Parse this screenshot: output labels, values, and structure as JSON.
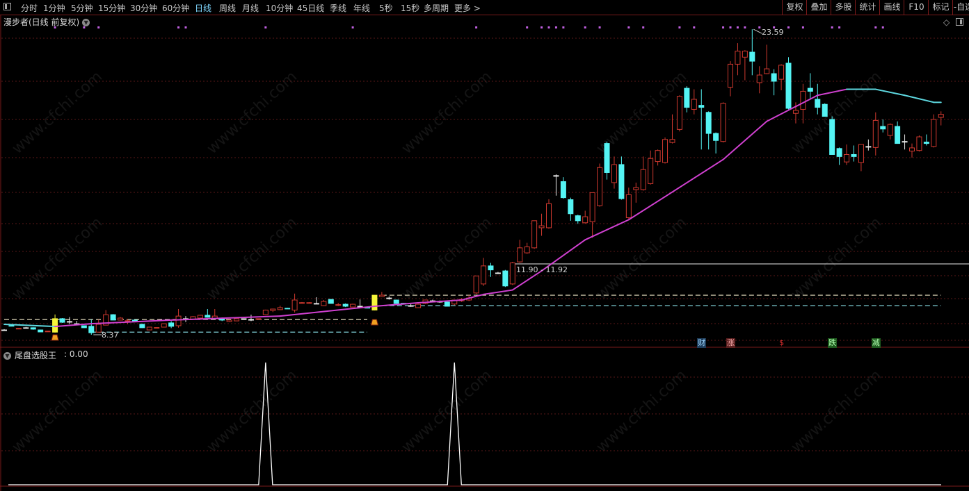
{
  "toolbar": {
    "periods": [
      "分时",
      "1分钟",
      "5分钟",
      "15分钟",
      "30分钟",
      "60分钟",
      "日线",
      "周线",
      "月线",
      "10分钟",
      "45日线",
      "季线",
      "年线",
      "5秒",
      "15秒",
      "多周期",
      "更多 >"
    ],
    "active": "日线",
    "right_buttons": [
      "复权",
      "叠加",
      "多股",
      "统计",
      "画线",
      "F10",
      "标记",
      "-自选"
    ]
  },
  "main_panel": {
    "title": "漫步者(日线 前复权)",
    "high_label": "23.59",
    "low_label": "8.37",
    "range_label": "11.90 - 11.92",
    "signals": [
      {
        "text": "财",
        "bg": "#1e3c5a",
        "color": "#9fd8ff",
        "index": 96
      },
      {
        "text": "涨",
        "bg": "#5a1e1e",
        "color": "#ffb0b0",
        "index": 100
      },
      {
        "text": "$",
        "bg": "transparent",
        "color": "#e03030",
        "index": 107
      },
      {
        "text": "跌",
        "bg": "#1e5a1e",
        "color": "#b0ffb0",
        "index": 114
      },
      {
        "text": "减",
        "bg": "#1e5a1e",
        "color": "#b0ffb0",
        "index": 120
      }
    ]
  },
  "indicator_panel": {
    "name": "尾盘选股王",
    "value": ": 0.00"
  },
  "watermark": "www.cfchi.com",
  "colors": {
    "up": "#d0392f",
    "down": "#54f4f4",
    "doji": "#e8e8e8",
    "highlight": "#f5f53a",
    "ma": "#d040d0",
    "ma_alt": "#5ed8e0",
    "marker": "#c060e0"
  },
  "chart_data": {
    "type": "candlestick",
    "ylim": [
      8.37,
      23.59
    ],
    "highlight_indices": [
      7,
      51
    ],
    "candles_ohlc": [
      [
        8.61,
        8.65,
        8.58,
        8.61
      ],
      [
        8.83,
        8.85,
        8.8,
        8.82
      ],
      [
        8.66,
        8.7,
        8.66,
        8.69
      ],
      [
        8.72,
        8.76,
        8.68,
        8.72
      ],
      [
        8.72,
        8.74,
        8.62,
        8.65
      ],
      [
        8.61,
        8.62,
        8.5,
        8.51
      ],
      [
        8.53,
        8.56,
        8.53,
        8.55
      ],
      [
        8.5,
        9.38,
        8.48,
        9.17
      ],
      [
        9.17,
        9.2,
        8.96,
        8.99
      ],
      [
        9.03,
        9.25,
        8.9,
        9.03
      ],
      [
        8.92,
        9.06,
        8.9,
        8.92
      ],
      [
        8.82,
        8.84,
        8.7,
        8.72
      ],
      [
        8.79,
        9.13,
        8.37,
        8.47
      ],
      [
        8.5,
        9.13,
        8.48,
        8.89
      ],
      [
        8.85,
        9.6,
        8.85,
        9.37
      ],
      [
        9.37,
        9.4,
        9.1,
        9.1
      ],
      [
        9.1,
        9.25,
        9.08,
        9.2
      ],
      [
        9.05,
        9.16,
        8.9,
        9.07
      ],
      [
        9.1,
        9.12,
        9.04,
        9.06
      ],
      [
        8.89,
        8.92,
        8.7,
        8.72
      ],
      [
        8.61,
        8.75,
        8.6,
        8.75
      ],
      [
        8.71,
        8.73,
        8.71,
        8.73
      ],
      [
        8.75,
        8.94,
        8.74,
        8.92
      ],
      [
        8.96,
        9.05,
        8.7,
        8.79
      ],
      [
        8.82,
        9.65,
        8.72,
        9.3
      ],
      [
        9.17,
        9.3,
        9.0,
        9.17
      ],
      [
        9.13,
        9.3,
        9.12,
        9.27
      ],
      [
        9.2,
        9.36,
        9.18,
        9.34
      ],
      [
        9.34,
        9.65,
        9.22,
        9.24
      ],
      [
        9.17,
        9.65,
        9.15,
        9.3
      ],
      [
        9.2,
        9.23,
        9.05,
        9.1
      ],
      [
        9.03,
        9.12,
        9.0,
        9.1
      ],
      [
        9.06,
        9.18,
        9.05,
        9.17
      ],
      [
        9.17,
        9.18,
        9.16,
        9.17
      ],
      [
        9.13,
        9.37,
        9.05,
        9.13
      ],
      [
        9.16,
        9.18,
        9.16,
        9.17
      ],
      [
        9.37,
        9.62,
        9.35,
        9.6
      ],
      [
        9.58,
        9.67,
        9.5,
        9.65
      ],
      [
        9.62,
        9.82,
        9.6,
        9.72
      ],
      [
        9.69,
        9.71,
        9.67,
        9.68
      ],
      [
        9.6,
        10.42,
        9.48,
        10.1
      ],
      [
        9.95,
        10.0,
        9.93,
        9.97
      ],
      [
        9.95,
        9.99,
        9.93,
        9.97
      ],
      [
        9.93,
        10.24,
        9.92,
        9.93
      ],
      [
        9.82,
        10.1,
        9.8,
        10.03
      ],
      [
        10.13,
        10.15,
        9.93,
        9.93
      ],
      [
        9.85,
        9.95,
        9.8,
        9.87
      ],
      [
        9.89,
        9.93,
        9.75,
        9.79
      ],
      [
        9.75,
        9.92,
        9.74,
        9.89
      ],
      [
        9.79,
        10.13,
        9.78,
        9.79
      ],
      [
        9.73,
        9.74,
        9.71,
        9.72
      ],
      [
        9.6,
        10.34,
        9.58,
        10.34
      ],
      [
        10.27,
        10.5,
        10.25,
        10.34
      ],
      [
        10.2,
        10.28,
        10.12,
        10.2
      ],
      [
        10.1,
        10.12,
        9.93,
        9.93
      ],
      [
        9.94,
        9.96,
        9.92,
        9.93
      ],
      [
        9.82,
        9.9,
        9.76,
        9.82
      ],
      [
        9.72,
        9.92,
        9.7,
        9.89
      ],
      [
        9.93,
        10.12,
        9.9,
        10.1
      ],
      [
        10.06,
        10.12,
        9.98,
        10.06
      ],
      [
        10.03,
        10.08,
        9.96,
        10.03
      ],
      [
        10.0,
        10.02,
        9.79,
        9.79
      ],
      [
        9.9,
        10.12,
        9.85,
        10.1
      ],
      [
        10.06,
        10.2,
        10.0,
        10.13
      ],
      [
        10.1,
        10.35,
        10.05,
        10.2
      ],
      [
        10.45,
        11.31,
        10.4,
        11.3
      ],
      [
        10.9,
        12.2,
        10.8,
        11.8
      ],
      [
        11.8,
        11.95,
        11.25,
        11.6
      ],
      [
        11.45,
        11.5,
        11.4,
        11.45
      ],
      [
        11.55,
        11.6,
        10.75,
        10.8
      ],
      [
        10.9,
        12.0,
        10.85,
        11.95
      ],
      [
        12.0,
        13.1,
        11.95,
        12.7
      ],
      [
        12.45,
        12.95,
        12.4,
        12.75
      ],
      [
        12.7,
        14.05,
        12.65,
        14.05
      ],
      [
        13.7,
        14.4,
        13.3,
        13.8
      ],
      [
        13.7,
        15.12,
        13.65,
        14.9
      ],
      [
        16.3,
        16.36,
        15.3,
        16.3
      ],
      [
        16.0,
        16.22,
        15.15,
        15.2
      ],
      [
        15.1,
        15.2,
        14.05,
        14.4
      ],
      [
        14.3,
        14.35,
        13.9,
        14.05
      ],
      [
        13.95,
        14.55,
        13.9,
        14.25
      ],
      [
        14.0,
        15.45,
        13.2,
        15.45
      ],
      [
        14.8,
        16.9,
        14.75,
        16.7
      ],
      [
        17.9,
        18.0,
        16.1,
        16.45
      ],
      [
        15.95,
        17.25,
        15.65,
        16.85
      ],
      [
        16.85,
        17.25,
        15.1,
        15.15
      ],
      [
        14.2,
        15.7,
        14.15,
        15.35
      ],
      [
        15.6,
        15.95,
        14.95,
        15.7
      ],
      [
        15.6,
        17.25,
        15.55,
        16.6
      ],
      [
        15.9,
        17.55,
        15.85,
        17.15
      ],
      [
        17.0,
        17.6,
        16.8,
        17.55
      ],
      [
        16.95,
        18.2,
        16.9,
        18.1
      ],
      [
        17.95,
        19.35,
        17.9,
        18.1
      ],
      [
        18.6,
        20.3,
        18.5,
        20.25
      ],
      [
        20.65,
        20.75,
        19.45,
        19.7
      ],
      [
        19.6,
        20.6,
        19.35,
        20.1
      ],
      [
        19.8,
        20.6,
        17.6,
        19.7
      ],
      [
        19.45,
        19.5,
        17.6,
        18.4
      ],
      [
        18.4,
        18.45,
        17.4,
        18.05
      ],
      [
        18.0,
        19.95,
        17.95,
        19.9
      ],
      [
        20.7,
        22.0,
        20.25,
        21.85
      ],
      [
        21.85,
        22.9,
        21.3,
        22.5
      ],
      [
        22.2,
        22.55,
        21.05,
        22.5
      ],
      [
        22.45,
        23.59,
        21.3,
        22.0
      ],
      [
        20.93,
        21.75,
        20.4,
        21.31
      ],
      [
        21.38,
        22.82,
        21.35,
        21.62
      ],
      [
        21.38,
        21.6,
        20.3,
        21.0
      ],
      [
        21.1,
        21.85,
        20.55,
        21.8
      ],
      [
        21.9,
        22.2,
        19.6,
        19.65
      ],
      [
        19.4,
        19.95,
        18.9,
        19.55
      ],
      [
        19.6,
        20.87,
        18.9,
        20.5
      ],
      [
        20.65,
        21.4,
        20.1,
        20.5
      ],
      [
        20.1,
        20.87,
        19.35,
        19.7
      ],
      [
        19.85,
        19.9,
        19.25,
        19.25
      ],
      [
        19.1,
        19.25,
        17.35,
        17.35
      ],
      [
        17.65,
        17.7,
        16.83,
        17.25
      ],
      [
        16.98,
        17.85,
        16.83,
        17.35
      ],
      [
        17.35,
        17.8,
        17.0,
        17.25
      ],
      [
        16.95,
        17.85,
        16.52,
        17.85
      ],
      [
        17.75,
        18.1,
        17.55,
        17.75
      ],
      [
        17.7,
        19.45,
        17.3,
        19.05
      ],
      [
        18.75,
        19.1,
        18.45,
        18.62
      ],
      [
        18.3,
        18.9,
        18.1,
        18.85
      ],
      [
        18.75,
        19.0,
        17.9,
        17.9
      ],
      [
        18.0,
        18.35,
        17.6,
        18.0
      ],
      [
        17.52,
        17.9,
        17.2,
        17.68
      ],
      [
        17.55,
        18.3,
        17.5,
        18.23
      ],
      [
        17.97,
        18.35,
        17.8,
        17.9
      ],
      [
        17.75,
        19.35,
        17.7,
        19.1
      ],
      [
        19.2,
        19.5,
        18.8,
        19.35
      ]
    ],
    "ma_line": [
      [
        0,
        8.89
      ],
      [
        7,
        8.78
      ],
      [
        12,
        8.92
      ],
      [
        23,
        9.1
      ],
      [
        38,
        9.3
      ],
      [
        51,
        9.79
      ],
      [
        57,
        9.96
      ],
      [
        63,
        10.1
      ],
      [
        66,
        10.38
      ],
      [
        70,
        10.6
      ],
      [
        74,
        11.55
      ],
      [
        80,
        13.1
      ],
      [
        86,
        14.1
      ],
      [
        91,
        15.25
      ],
      [
        99,
        17.1
      ],
      [
        105,
        19.0
      ],
      [
        112,
        20.3
      ],
      [
        116,
        20.6
      ],
      [
        120,
        20.6
      ],
      [
        124,
        20.3
      ],
      [
        128,
        19.95
      ],
      [
        129,
        19.95
      ]
    ],
    "ma_alt_color_ranges": [
      [
        0,
        7
      ],
      [
        116,
        129
      ]
    ],
    "reference_lines": [
      {
        "price": 9.13,
        "from": 0,
        "to": 50,
        "color": "#e8e0c0",
        "style": "dashed"
      },
      {
        "price": 8.5,
        "from": 12,
        "to": 50,
        "color": "#7fd0d8",
        "style": "dashed"
      },
      {
        "price": 10.34,
        "from": 52,
        "to": 129,
        "color": "#e8e0c0",
        "style": "dashed"
      },
      {
        "price": 9.82,
        "from": 52,
        "to": 129,
        "color": "#7fd0d8",
        "style": "dashed"
      },
      {
        "price": 11.9,
        "from": 70,
        "to": 133,
        "color": "#bdbdbd",
        "style": "solid"
      }
    ],
    "top_markers": [
      7,
      11,
      13,
      24,
      25,
      36,
      48,
      65,
      72,
      74,
      75,
      76,
      77,
      80,
      82,
      86,
      88,
      93,
      95,
      99,
      100,
      101,
      102,
      104,
      106,
      108,
      110,
      114,
      115,
      120,
      121
    ],
    "indicator": {
      "ylim": [
        0,
        1
      ],
      "spike_indices": [
        36,
        62
      ]
    }
  }
}
